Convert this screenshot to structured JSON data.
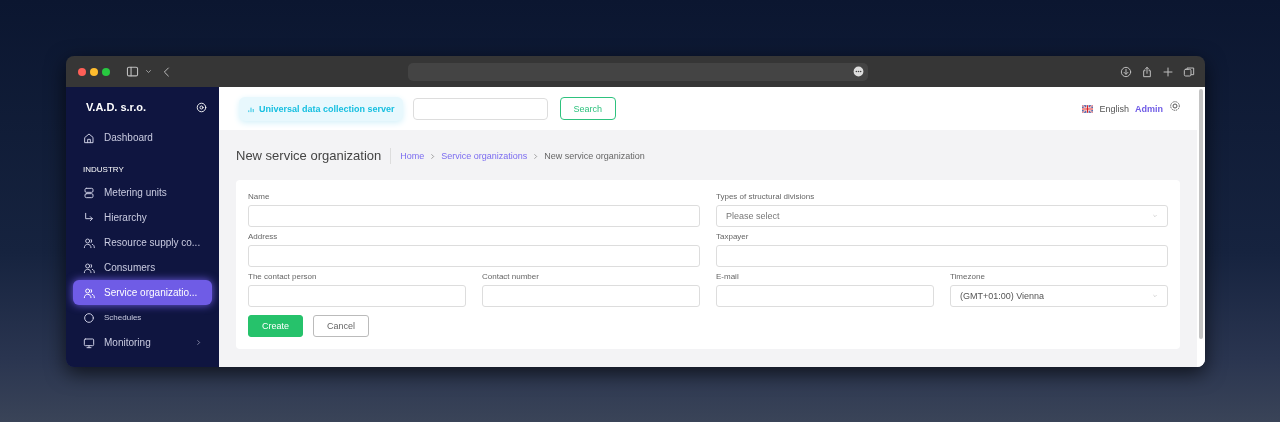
{
  "sidebar": {
    "brand": "V.A.D. s.r.o.",
    "items": [
      {
        "kind": "link",
        "label": "Dashboard",
        "selected": false
      },
      {
        "kind": "section",
        "label": "INDUSTRY"
      },
      {
        "kind": "link",
        "label": "Metering units",
        "selected": false
      },
      {
        "kind": "link",
        "label": "Hierarchy",
        "selected": false
      },
      {
        "kind": "link",
        "label": "Resource supply co...",
        "selected": false
      },
      {
        "kind": "link",
        "label": "Consumers",
        "selected": false
      },
      {
        "kind": "link",
        "label": "Service organizatio...",
        "selected": true
      },
      {
        "kind": "small",
        "label": "Schedules",
        "selected": false
      },
      {
        "kind": "group",
        "label": "Monitoring",
        "selected": false
      }
    ]
  },
  "topbar": {
    "app_badge": "Universal data collection server",
    "search_button": "Search",
    "language": "English",
    "user": "Admin"
  },
  "page": {
    "title": "New service organization",
    "breadcrumbs": [
      {
        "label": "Home",
        "link": true
      },
      {
        "label": "Service organizations",
        "link": true
      },
      {
        "label": "New service organization",
        "link": false
      }
    ]
  },
  "form": {
    "rows": [
      [
        {
          "label": "Name",
          "kind": "input"
        },
        {
          "label": "Types of structural divisions",
          "kind": "select",
          "placeholder": "Please select"
        }
      ],
      [
        {
          "label": "Address",
          "kind": "input"
        },
        {
          "label": "Taxpayer",
          "kind": "input"
        }
      ],
      [
        {
          "label": "The contact person",
          "kind": "input"
        },
        {
          "label": "Contact number",
          "kind": "input"
        },
        {
          "label": "E-mail",
          "kind": "input"
        },
        {
          "label": "Timezone",
          "kind": "select",
          "value": "(GMT+01:00) Vienna"
        }
      ]
    ],
    "buttons": [
      {
        "label": "Create",
        "kind": "primary"
      },
      {
        "label": "Cancel",
        "kind": "secondary"
      }
    ]
  }
}
